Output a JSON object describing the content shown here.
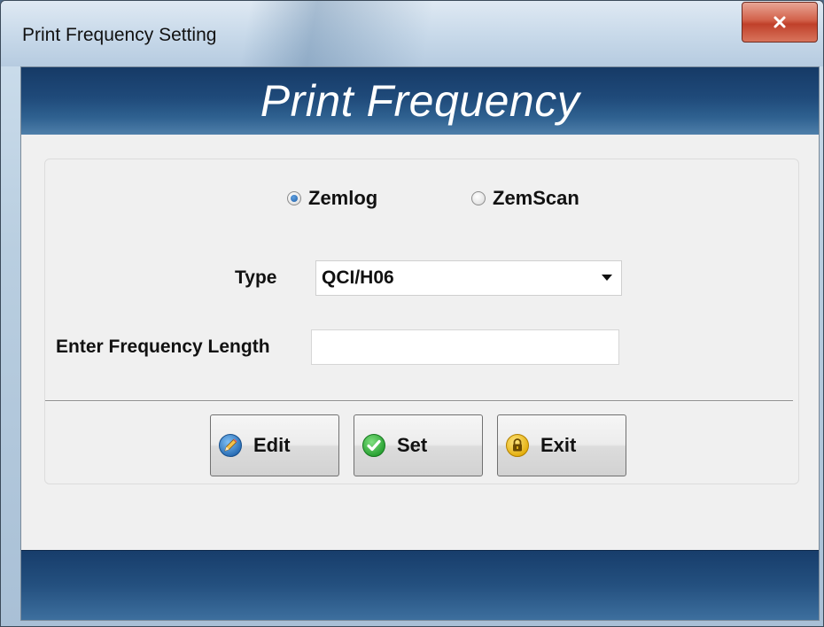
{
  "window": {
    "title": "Print Frequency Setting",
    "close_label": "x"
  },
  "header": {
    "title": "Print Frequency"
  },
  "device": {
    "options": [
      {
        "label": "Zemlog",
        "selected": true
      },
      {
        "label": "ZemScan",
        "selected": false
      }
    ]
  },
  "form": {
    "type_label": "Type",
    "type_value": "QCI/H06",
    "length_label": "Enter Frequency Length",
    "length_value": ""
  },
  "buttons": {
    "edit": {
      "label": "Edit",
      "icon": "pencil-icon"
    },
    "set": {
      "label": "Set",
      "icon": "checkmark-icon"
    },
    "exit": {
      "label": "Exit",
      "icon": "lock-icon"
    }
  },
  "colors": {
    "header_band": "#1f4a7a",
    "close_button": "#c9503a",
    "check_green": "#2faa3a",
    "lock_yellow": "#f3c21b",
    "pencil_blue": "#2d7cc9"
  }
}
